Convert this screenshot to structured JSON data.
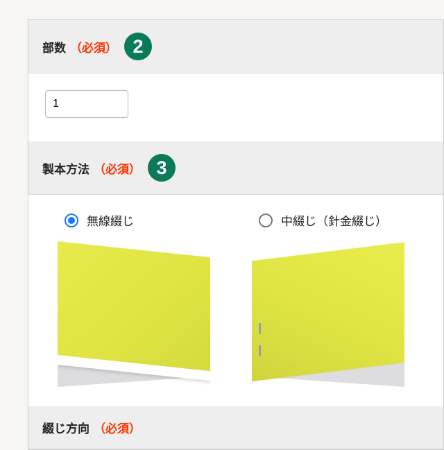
{
  "sections": {
    "quantity": {
      "title": "部数",
      "required": "（必須）",
      "badge": "2",
      "value": "1"
    },
    "binding": {
      "title": "製本方法",
      "required": "（必須）",
      "badge": "3",
      "options": [
        {
          "label": "無線綴じ",
          "selected": true
        },
        {
          "label": "中綴じ（針金綴じ）",
          "selected": false
        }
      ]
    },
    "direction": {
      "title": "綴じ方向",
      "required": "（必須）"
    }
  }
}
